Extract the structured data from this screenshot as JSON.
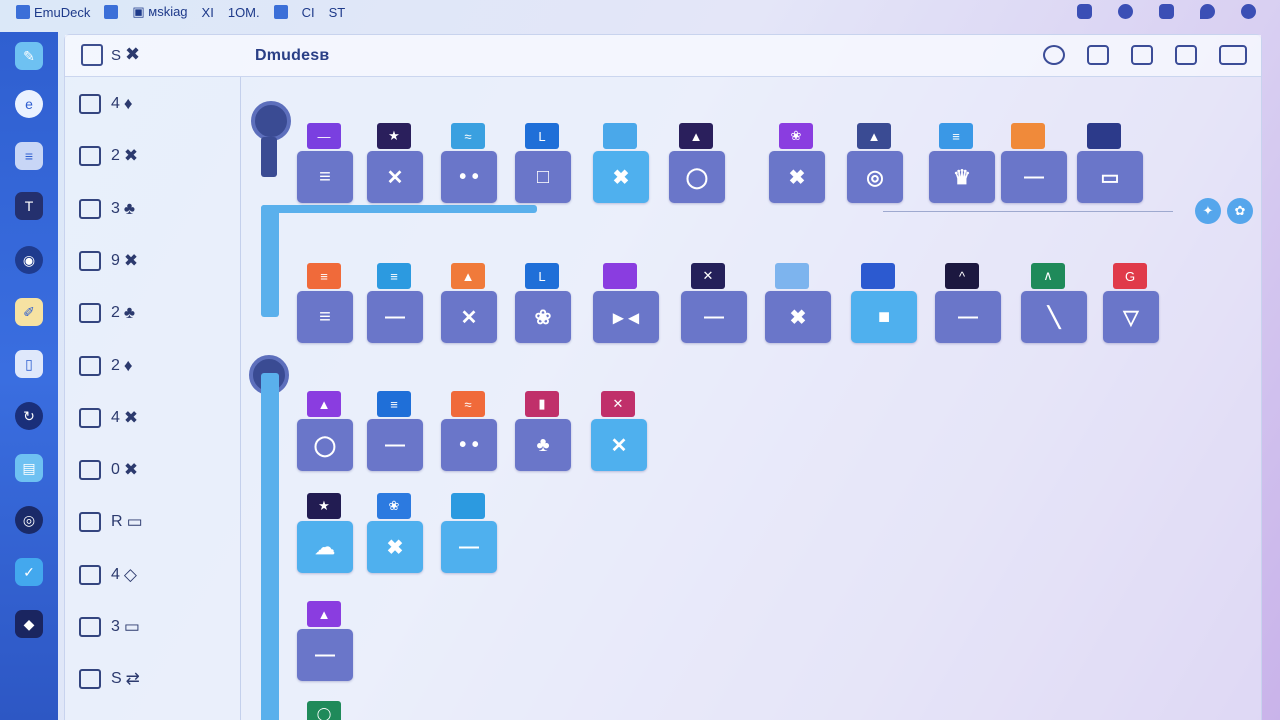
{
  "topbar": {
    "items": [
      {
        "label": "EmuDeck",
        "icon": "app-logo-icon"
      },
      {
        "label": "",
        "icon": "gamepad-icon"
      },
      {
        "label": "▣ мskiag",
        "icon": "grid-icon"
      },
      {
        "label": "XI",
        "icon": ""
      },
      {
        "label": "1OM.",
        "icon": ""
      },
      {
        "label": "",
        "icon": "controller-icon"
      },
      {
        "label": "CI",
        "icon": ""
      },
      {
        "label": "ST",
        "icon": ""
      }
    ]
  },
  "window": {
    "title": "Dmudesв",
    "header_label": "S",
    "header_glyph": "✖"
  },
  "sidebar": {
    "items": [
      {
        "label": "4",
        "glyph": "♦"
      },
      {
        "label": "2",
        "glyph": "✖"
      },
      {
        "label": "3",
        "glyph": "♣"
      },
      {
        "label": "9",
        "glyph": "✖"
      },
      {
        "label": "2",
        "glyph": "♣"
      },
      {
        "label": "2",
        "glyph": "♦"
      },
      {
        "label": "4",
        "glyph": "✖"
      },
      {
        "label": "0",
        "glyph": "✖"
      },
      {
        "label": "R",
        "glyph": "▭"
      },
      {
        "label": "4",
        "glyph": "◇"
      },
      {
        "label": "3",
        "glyph": "▭"
      },
      {
        "label": "S",
        "glyph": "⇄"
      }
    ]
  },
  "tiles": {
    "row1": [
      {
        "glyph": "≡",
        "tab": "—",
        "tab_color": "#7a3fe0"
      },
      {
        "glyph": "✕",
        "tab": "★",
        "tab_color": "#2a1f5c"
      },
      {
        "glyph": "• •",
        "tab": "≈",
        "tab_color": "#3aa0e0"
      },
      {
        "glyph": "□",
        "tab": "L",
        "tab_color": "#1f6fd8"
      },
      {
        "glyph": "✖",
        "tab": "",
        "tab_color": "#4aa8ea"
      },
      {
        "glyph": "◯",
        "tab": "▲",
        "tab_color": "#2a1f5c"
      },
      {
        "glyph": "✖",
        "tab": "❀",
        "tab_color": "#8a3de0"
      },
      {
        "glyph": "◎",
        "tab": "▲",
        "tab_color": "#3a4b93"
      },
      {
        "glyph": "♛",
        "tab": "≡",
        "tab_color": "#3a98e6"
      },
      {
        "glyph": "—",
        "tab": "",
        "tab_color": "#f08a3a"
      },
      {
        "glyph": "▭",
        "tab": "",
        "tab_color": "#2c3a8a"
      }
    ],
    "row2": [
      {
        "glyph": "≡",
        "tab": "≡",
        "tab_color": "#f06a3a"
      },
      {
        "glyph": "—",
        "tab": "≡",
        "tab_color": "#2c9ae0"
      },
      {
        "glyph": "✕",
        "tab": "▲",
        "tab_color": "#f07a3a"
      },
      {
        "glyph": "❀",
        "tab": "L",
        "tab_color": "#1f6fd8"
      },
      {
        "glyph": "▸ ◂",
        "tab": "",
        "tab_color": "#8a3de0"
      },
      {
        "glyph": "—",
        "tab": "✕",
        "tab_color": "#24205a"
      },
      {
        "glyph": "✖",
        "tab": "",
        "tab_color": "#7db4ee"
      },
      {
        "glyph": "■",
        "tab": "",
        "tab_color": "#2c5ad0"
      },
      {
        "glyph": "—",
        "tab": "^",
        "tab_color": "#1c1840"
      },
      {
        "glyph": "╲",
        "tab": "∧",
        "tab_color": "#1f8a5a"
      },
      {
        "glyph": "▽",
        "tab": "G",
        "tab_color": "#e03a4a"
      }
    ],
    "row3": [
      {
        "glyph": "◯",
        "tab": "▲",
        "tab_color": "#8a3de0"
      },
      {
        "glyph": "—",
        "tab": "≡",
        "tab_color": "#1f6fd8"
      },
      {
        "glyph": "• •",
        "tab": "≈",
        "tab_color": "#f06a3a"
      },
      {
        "glyph": "♣",
        "tab": "▮",
        "tab_color": "#c0306a"
      },
      {
        "glyph": "✕",
        "tab": "✕",
        "tab_color": "#c0306a"
      }
    ],
    "row4": [
      {
        "glyph": "☁",
        "tab": "★",
        "tab_color": "#221c52"
      },
      {
        "glyph": "✖",
        "tab": "❀",
        "tab_color": "#2c7ae0"
      },
      {
        "glyph": "—",
        "tab": "",
        "tab_color": "#2c9ae0"
      }
    ],
    "row5": [
      {
        "glyph": "—",
        "tab": "▲",
        "tab_color": "#8a3de0"
      }
    ],
    "row6": [
      {
        "glyph": "",
        "tab": "◯",
        "tab_color": "#1f8a5a"
      }
    ]
  },
  "colors": {
    "dock_bg": "#2f5fd0",
    "tile_bg": "#6a76c9",
    "tile_light": "#4fb0ee",
    "rail": "#5ab0ec"
  },
  "pills": [
    "✦",
    "✿"
  ]
}
